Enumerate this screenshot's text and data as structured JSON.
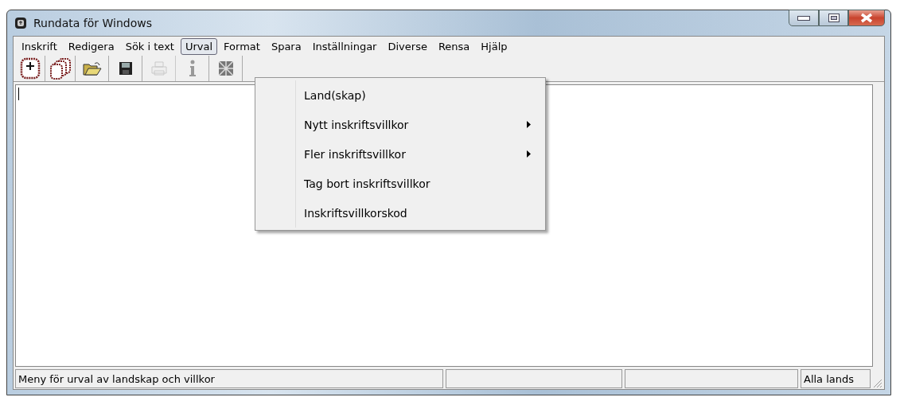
{
  "window": {
    "title": "Rundata för Windows"
  },
  "menu_bar": [
    {
      "label": "Inskrift",
      "selected": false
    },
    {
      "label": "Redigera",
      "selected": false
    },
    {
      "label": "Sök i text",
      "selected": false
    },
    {
      "label": "Urval",
      "selected": true
    },
    {
      "label": "Format",
      "selected": false
    },
    {
      "label": "Spara",
      "selected": false
    },
    {
      "label": "Inställningar",
      "selected": false
    },
    {
      "label": "Diverse",
      "selected": false
    },
    {
      "label": "Rensa",
      "selected": false
    },
    {
      "label": "Hjälp",
      "selected": false
    }
  ],
  "toolbar": [
    {
      "kind": "new",
      "disabled": false
    },
    {
      "kind": "multi",
      "disabled": false
    },
    {
      "kind": "open",
      "disabled": false
    },
    {
      "kind": "save",
      "disabled": false
    },
    {
      "kind": "print",
      "disabled": true
    },
    {
      "kind": "info",
      "disabled": false
    },
    {
      "kind": "grid",
      "disabled": false
    }
  ],
  "dropdown": [
    {
      "label": "Land(skap)",
      "submenu": false
    },
    {
      "label": "Nytt inskriftsvillkor",
      "submenu": true
    },
    {
      "label": "Fler inskriftsvillkor",
      "submenu": true
    },
    {
      "label": "Tag bort inskriftsvillkor",
      "submenu": false
    },
    {
      "label": "Inskriftsvillkorskod",
      "submenu": false
    }
  ],
  "status_bar": {
    "message": "Meny för urval av landskap och villkor",
    "indicator": "Alla lands"
  }
}
